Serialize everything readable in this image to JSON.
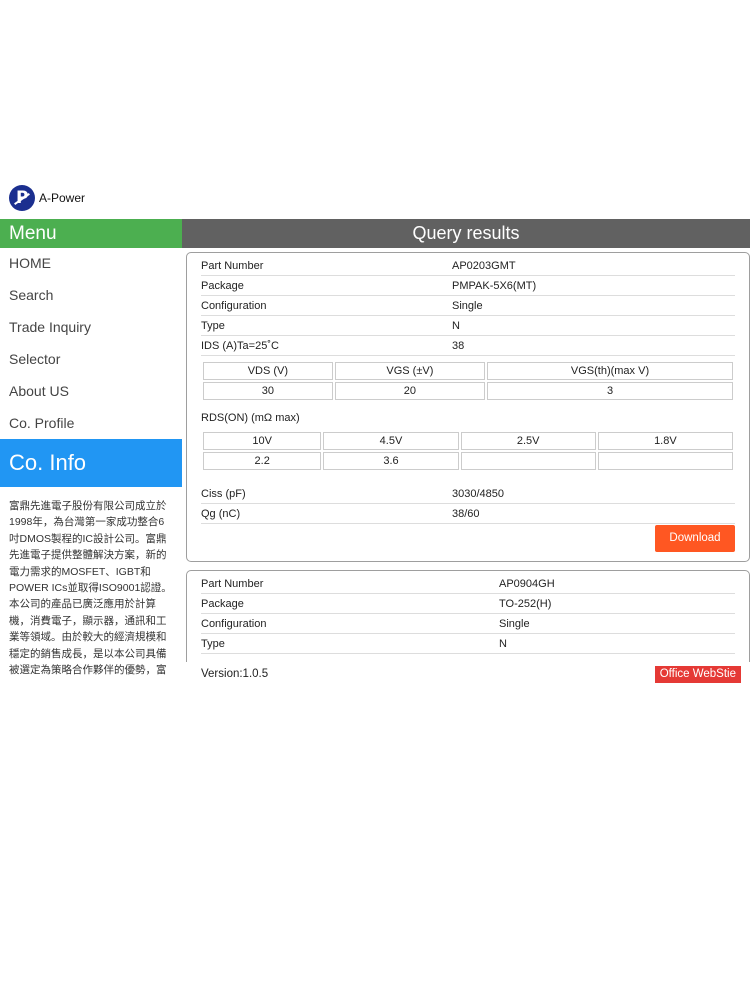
{
  "brand": {
    "name": "A-Power",
    "logo_icon": "a-power-logo-icon",
    "logo_color": "#1b2f8f"
  },
  "menu": {
    "title": "Menu",
    "color": "#4caf50",
    "items": [
      {
        "label": "HOME"
      },
      {
        "label": "Search"
      },
      {
        "label": "Trade Inquiry"
      },
      {
        "label": "Selector"
      },
      {
        "label": "About US"
      },
      {
        "label": "Co. Profile"
      }
    ]
  },
  "coinfo": {
    "title": "Co. Info",
    "color": "#2196f3",
    "text": "富鼎先進電子股份有限公司成立於1998年，為台灣第一家成功整合6吋DMOS製程的IC設計公司。富鼎先進電子提供整體解決方案，新的電力需求的MOSFET、IGBT和POWER ICs並取得ISO9001認證。本公司的產品已廣泛應用於計算機，消費電子，顯示器，通訊和工業等領域。由於較大的經濟規模和穩定的銷售成長，是以本公司具備被選定為策略合作夥伴的優勢，富"
  },
  "query": {
    "title": "Query results",
    "color": "#616161"
  },
  "card1": {
    "part_number_label": "Part Number",
    "part_number": "AP0203GMT",
    "package_label": "Package",
    "package": "PMPAK-5X6(MT)",
    "configuration_label": "Configuration",
    "configuration": "Single",
    "type_label": "Type",
    "type": "N",
    "ids_label": "IDS (A)Ta=25˚C",
    "ids": "38",
    "v_headers": [
      "VDS (V)",
      "VGS (±V)",
      "VGS(th)(max V)"
    ],
    "v_values": [
      "30",
      "20",
      "3"
    ],
    "rds_label": "RDS(ON) (mΩ max)",
    "rds_headers": [
      "10V",
      "4.5V",
      "2.5V",
      "1.8V"
    ],
    "rds_values": [
      "2.2",
      "3.6",
      "",
      ""
    ],
    "ciss_label": "Ciss (pF)",
    "ciss": "3030/4850",
    "qg_label": "Qg (nC)",
    "qg": "38/60",
    "download_label": "Download"
  },
  "card2": {
    "part_number_label": "Part Number",
    "part_number": "AP0904GH",
    "package_label": "Package",
    "package": "TO-252(H)",
    "configuration_label": "Configuration",
    "configuration": "Single",
    "type_label": "Type",
    "type": "N"
  },
  "footer": {
    "version": "Version:1.0.5",
    "office_label": "Office WebStie",
    "office_color": "#e53935"
  },
  "accent": {
    "download_color": "#ff5722"
  }
}
